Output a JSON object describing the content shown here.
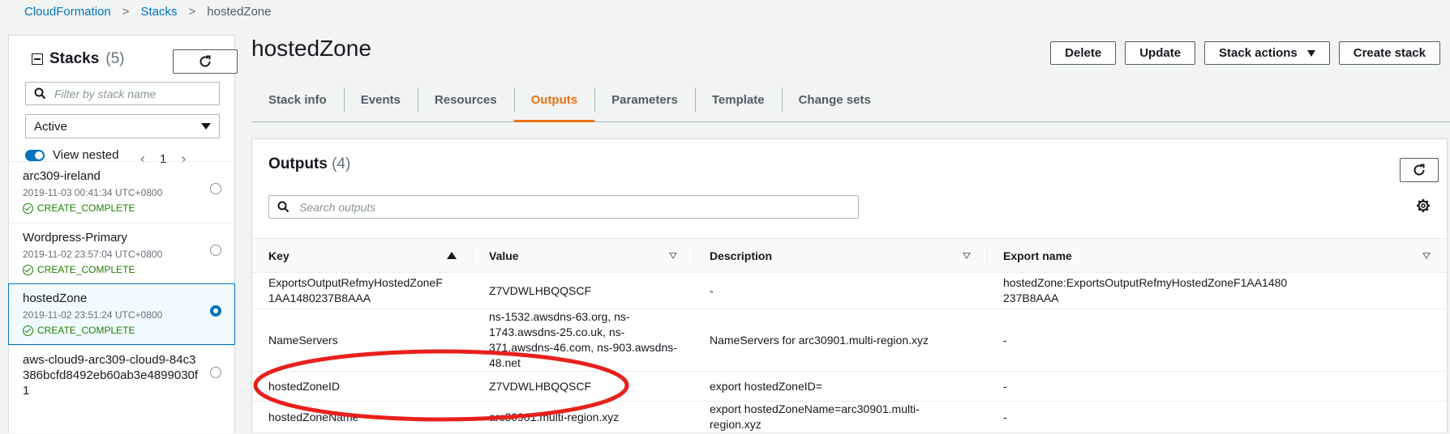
{
  "breadcrumb": {
    "items": [
      "CloudFormation",
      "Stacks"
    ],
    "current": "hostedZone"
  },
  "sidebar": {
    "title": "Stacks",
    "count": "(5)",
    "filter_placeholder": "Filter by stack name",
    "status_select": "Active",
    "view_nested_label": "View nested",
    "page": "1",
    "stacks": [
      {
        "name": "arc309-ireland",
        "date": "2019-11-03 00:41:34 UTC+0800",
        "status": "CREATE_COMPLETE"
      },
      {
        "name": "Wordpress-Primary",
        "date": "2019-11-02 23:57:04 UTC+0800",
        "status": "CREATE_COMPLETE"
      },
      {
        "name": "hostedZone",
        "date": "2019-11-02 23:51:24 UTC+0800",
        "status": "CREATE_COMPLETE"
      },
      {
        "name": "aws-cloud9-arc309-cloud9-84c3386bcfd8492eb60ab3e4899030f1"
      }
    ]
  },
  "main": {
    "title": "hostedZone",
    "actions": {
      "delete": "Delete",
      "update": "Update",
      "stack_actions": "Stack actions",
      "create": "Create stack"
    },
    "tabs": [
      "Stack info",
      "Events",
      "Resources",
      "Outputs",
      "Parameters",
      "Template",
      "Change sets"
    ],
    "active_tab": "Outputs",
    "outputs": {
      "title": "Outputs",
      "count": "(4)",
      "search_placeholder": "Search outputs",
      "columns": [
        "Key",
        "Value",
        "Description",
        "Export name"
      ],
      "rows": [
        {
          "key": "ExportsOutputRefmyHostedZoneF1AA1480237B8AAA",
          "value": "Z7VDWLHBQQSCF",
          "description": "-",
          "export": "hostedZone:ExportsOutputRefmyHostedZoneF1AA1480237B8AAA"
        },
        {
          "key": "NameServers",
          "value": "ns-1532.awsdns-63.org, ns-1743.awsdns-25.co.uk, ns-371.awsdns-46.com, ns-903.awsdns-48.net",
          "description": "NameServers for arc30901.multi-region.xyz",
          "export": "-"
        },
        {
          "key": "hostedZoneID",
          "value": "Z7VDWLHBQQSCF",
          "description": "export hostedZoneID=",
          "export": "-"
        },
        {
          "key": "hostedZoneName",
          "value": "arc30901.multi-region.xyz",
          "description": "export hostedZoneName=arc30901.multi-region.xyz",
          "export": "-"
        }
      ]
    }
  },
  "colors": {
    "accent": "#ec7211",
    "link": "#0073bb",
    "success": "#1d8102",
    "annotation": "#e8201c"
  },
  "icons": [
    "refresh-icon",
    "search-icon",
    "gear-icon",
    "sort-ascending-icon",
    "sort-icon",
    "check-circle-icon",
    "caret-down-icon"
  ]
}
